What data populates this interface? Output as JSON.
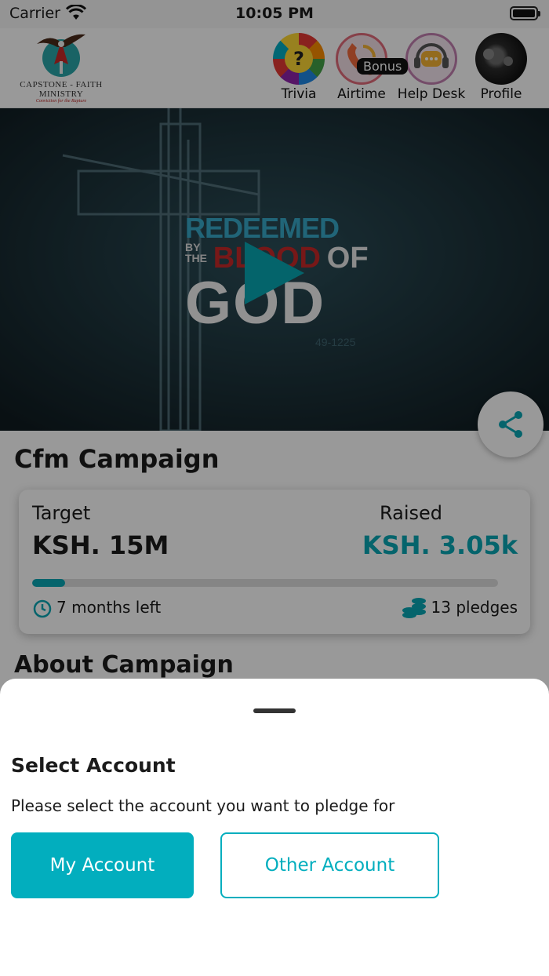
{
  "status_bar": {
    "carrier": "Carrier",
    "time": "10:05 PM"
  },
  "header": {
    "logo": {
      "name": "CAPSTONE - FAITH",
      "name2": "MINISTRY",
      "motto": "Conviction for the Rapture"
    },
    "nav": [
      {
        "label": "Trivia",
        "icon": "trivia-icon"
      },
      {
        "label": "Airtime",
        "icon": "phone-icon",
        "badge": "Bonus"
      },
      {
        "label": "Help Desk",
        "icon": "help-desk-icon"
      },
      {
        "label": "Profile",
        "icon": "profile-avatar"
      }
    ]
  },
  "hero": {
    "line1": "REDEEMED",
    "line2a": "BY",
    "line2b": "THE",
    "line2c": "BLOOD",
    "line2d": "OF",
    "line3": "GOD",
    "ref": "49-1225"
  },
  "campaign": {
    "title": "Cfm Campaign",
    "target_label": "Target",
    "target_value": "KSH. 15M",
    "raised_label": "Raised",
    "raised_value": "KSH. 3.05k",
    "progress_percent": 7,
    "time_left": "7 months left",
    "pledges": "13 pledges",
    "about_heading": "About Campaign"
  },
  "sheet": {
    "title": "Select Account",
    "description": "Please select the account you want to pledge for",
    "primary_button": "My Account",
    "secondary_button": "Other Account"
  },
  "colors": {
    "accent": "#02aebe",
    "raised": "#09a7b4",
    "overlay": "rgba(0,0,0,0.4)"
  }
}
